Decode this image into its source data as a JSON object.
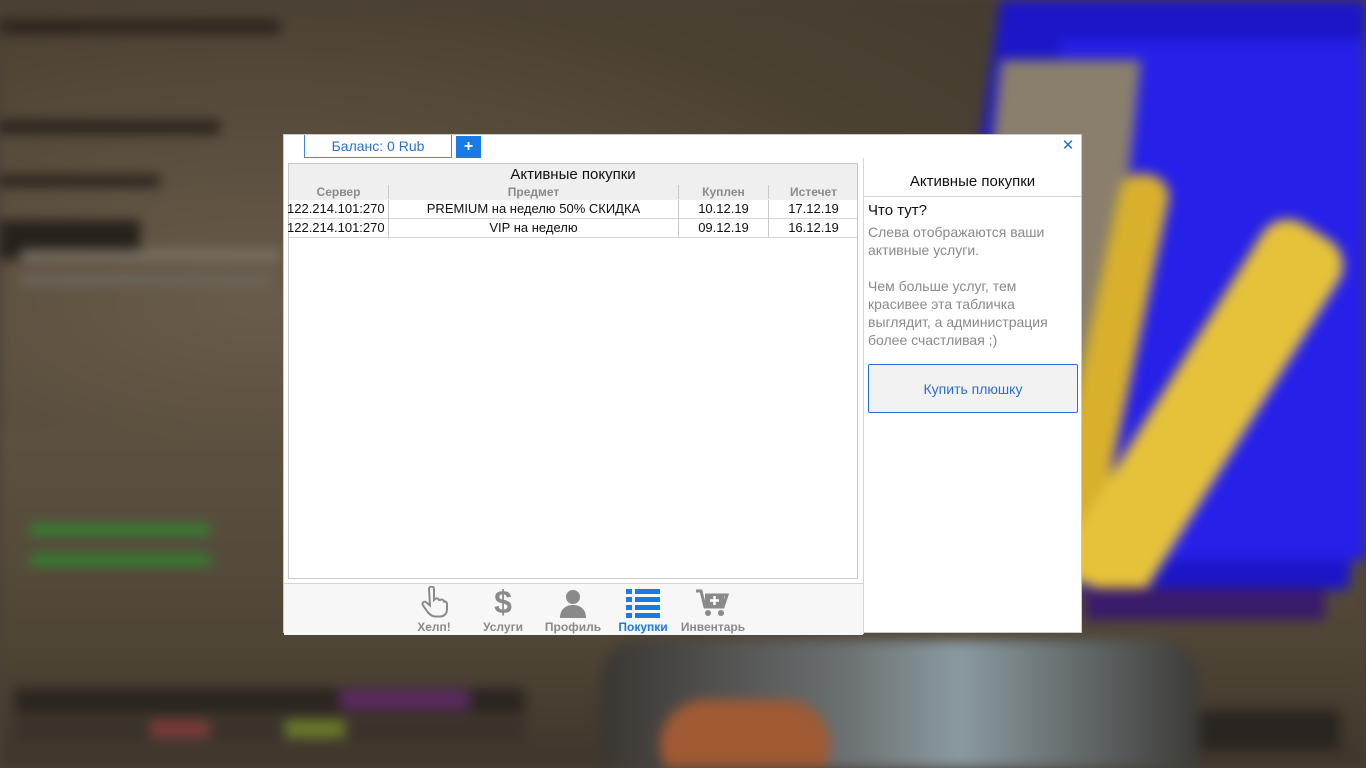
{
  "header": {
    "balance_tab": "Баланс: 0 Rub",
    "add_button": "+",
    "close_icon": "close-icon"
  },
  "table": {
    "title": "Активные покупки",
    "columns": [
      "Сервер",
      "Предмет",
      "Куплен",
      "Истечет"
    ],
    "rows": [
      {
        "server": "122.214.101:270",
        "item": "PREMIUM на неделю 50% СКИДКА",
        "bought": "10.12.19",
        "expires": "17.12.19"
      },
      {
        "server": "122.214.101:270",
        "item": "VIP на неделю",
        "bought": "09.12.19",
        "expires": "16.12.19"
      }
    ]
  },
  "nav": {
    "items": [
      {
        "label": "Хелп!",
        "icon": "hand-pointer-icon",
        "active": false
      },
      {
        "label": "Услуги",
        "icon": "dollar-icon",
        "active": false
      },
      {
        "label": "Профиль",
        "icon": "user-icon",
        "active": false
      },
      {
        "label": "Покупки",
        "icon": "list-icon",
        "active": true
      },
      {
        "label": "Инвентарь",
        "icon": "cart-plus-icon",
        "active": false
      }
    ]
  },
  "sidebar": {
    "title": "Активные покупки",
    "question": "Что тут?",
    "text1": "Слева отображаются ваши активные услуги.",
    "text2": "Чем больше услуг, тем красивее эта табличка выглядит, а администрация более счастливая ;)",
    "buy_button": "Купить плюшку"
  },
  "colors": {
    "accent": "#1a7ae6",
    "muted_text": "#8a8a8a"
  }
}
